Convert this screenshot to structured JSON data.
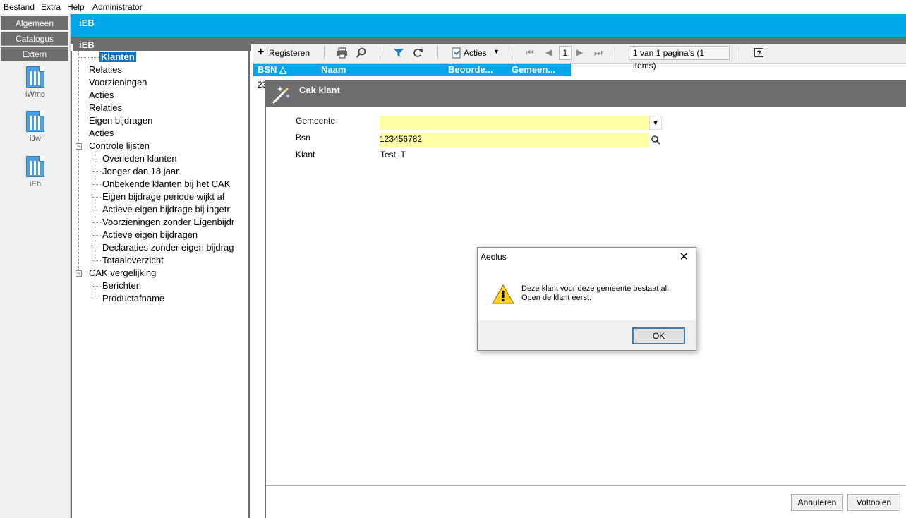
{
  "menubar": {
    "items": [
      "Bestand",
      "Extra",
      "Help",
      "Administrator"
    ]
  },
  "app_title": "iEB",
  "leftnav": {
    "tabs": [
      "Algemeen",
      "Catalogus",
      "Extern"
    ],
    "apps": [
      "iWmo",
      "iJw",
      "iEb"
    ]
  },
  "tree": {
    "header": "iEB",
    "selected": "Klanten",
    "items": [
      "Relaties",
      "Voorzieningen",
      "Acties",
      "Relaties",
      "Eigen bijdragen",
      "Acties",
      "Controle lijsten",
      "Overleden klanten",
      "Jonger dan 18 jaar",
      "Onbekende klanten bij het CAK",
      "Eigen bijdrage periode wijkt af",
      "Actieve eigen bijdrage bij ingetr",
      "Voorzieningen zonder Eigenbijdr",
      "Actieve eigen bijdragen",
      "Declaraties zonder eigen bijdrag",
      "Totaaloverzicht",
      "CAK vergelijking",
      "Berichten",
      "Productafname"
    ]
  },
  "toolbar": {
    "register_label": "Registeren",
    "acties_label": "Acties",
    "page_input": "1",
    "page_info": "1 van 1 pagina's (1 items)"
  },
  "grid": {
    "columns": [
      "BSN △",
      "Naam",
      "Beoorde...",
      "Gemeen..."
    ],
    "first_cell_partial": "23"
  },
  "cak": {
    "title": "Cak klant",
    "gemeente_label": "Gemeente",
    "gemeente_value": "",
    "bsn_label": "Bsn",
    "bsn_value": "123456782",
    "klant_label": "Klant",
    "klant_value": "Test, T",
    "cancel_label": "Annuleren",
    "finish_label": "Voltooien"
  },
  "dialog": {
    "title": "Aeolus",
    "close_glyph": "✕",
    "message_line1": "Deze klant voor deze gemeente bestaat al.",
    "message_line2": "Open de klant eerst.",
    "ok_label": "OK"
  },
  "colors": {
    "accent_blue": "#00a7e8",
    "header_gray": "#6e6e6e",
    "field_yellow": "#ffffa8",
    "selection_blue": "#0a74c9"
  }
}
